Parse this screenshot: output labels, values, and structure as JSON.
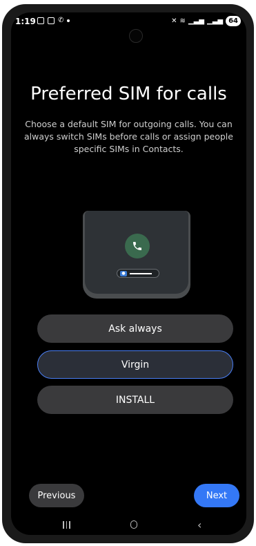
{
  "status_bar": {
    "time": "1:19",
    "battery": "64",
    "left_icons": [
      "screenshot-icon",
      "gallery-icon",
      "phone-icon",
      "dot-icon"
    ],
    "right_icons": [
      "mute-icon",
      "wifi-icon",
      "signal-icon",
      "signal-icon-2"
    ]
  },
  "page": {
    "title": "Preferred SIM for calls",
    "description": "Choose a default SIM for outgoing calls. You can always switch SIMs before calls or assign people specific SIMs in Contacts."
  },
  "options": [
    {
      "label": "Ask always",
      "selected": false
    },
    {
      "label": "Virgin",
      "selected": true
    },
    {
      "label": "INSTALL",
      "selected": false
    }
  ],
  "footer": {
    "previous_label": "Previous",
    "next_label": "Next"
  },
  "colors": {
    "accent": "#3478f6",
    "background": "#000000",
    "option_bg": "#3a3a3c",
    "call_icon_bg": "#3a6a4e"
  }
}
